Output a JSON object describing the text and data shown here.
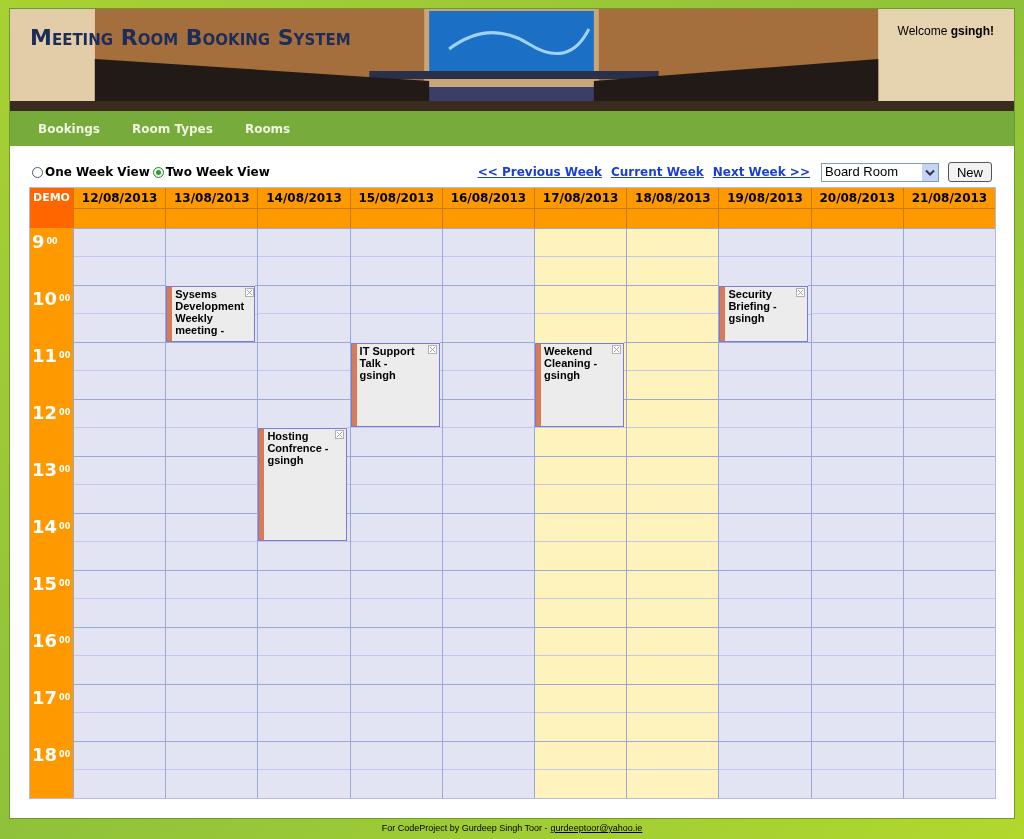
{
  "header": {
    "title": "Meeting Room Booking System",
    "welcome": "Welcome **gsingh!**"
  },
  "nav": [
    "Bookings",
    "Room Types",
    "Rooms"
  ],
  "views": [
    {
      "label": "One Week View",
      "selected": false
    },
    {
      "label": "Two Week View",
      "selected": true
    }
  ],
  "links": [
    "<< Previous Week",
    "Current Week",
    "Next Week >>"
  ],
  "room_select": {
    "value": "Board Room"
  },
  "new_button": "New",
  "calendar": {
    "corner": "DEMO",
    "hours": [
      {
        "hour": "9",
        "minutes": "00"
      },
      {
        "hour": "10",
        "minutes": "00"
      },
      {
        "hour": "11",
        "minutes": "00"
      },
      {
        "hour": "12",
        "minutes": "00"
      },
      {
        "hour": "13",
        "minutes": "00"
      },
      {
        "hour": "14",
        "minutes": "00"
      },
      {
        "hour": "15",
        "minutes": "00"
      },
      {
        "hour": "16",
        "minutes": "00"
      },
      {
        "hour": "17",
        "minutes": "00"
      },
      {
        "hour": "18",
        "minutes": "00"
      }
    ],
    "days": [
      {
        "date": "12/08/2013",
        "weekend": false,
        "slots": [
          {
            "kind": "free"
          },
          {
            "kind": "free"
          },
          {
            "kind": "free"
          },
          {
            "kind": "free"
          },
          {
            "kind": "free"
          },
          {
            "kind": "free"
          },
          {
            "kind": "free"
          },
          {
            "kind": "free"
          },
          {
            "kind": "free"
          },
          {
            "kind": "free"
          },
          {
            "kind": "free"
          },
          {
            "kind": "free"
          },
          {
            "kind": "free"
          },
          {
            "kind": "free"
          },
          {
            "kind": "free"
          },
          {
            "kind": "free"
          },
          {
            "kind": "free"
          },
          {
            "kind": "free"
          },
          {
            "kind": "free"
          },
          {
            "kind": "free"
          }
        ]
      },
      {
        "date": "13/08/2013",
        "weekend": false,
        "slots": [
          {
            "kind": "free"
          },
          {
            "kind": "free"
          },
          {
            "kind": "booking",
            "title": "Sysems Development Weekly meeting -"
          },
          {
            "kind": "booked"
          },
          {
            "kind": "free"
          },
          {
            "kind": "free"
          },
          {
            "kind": "free"
          },
          {
            "kind": "free"
          },
          {
            "kind": "free"
          },
          {
            "kind": "free"
          },
          {
            "kind": "free"
          },
          {
            "kind": "free"
          },
          {
            "kind": "free"
          },
          {
            "kind": "free"
          },
          {
            "kind": "free"
          },
          {
            "kind": "free"
          },
          {
            "kind": "free"
          },
          {
            "kind": "free"
          },
          {
            "kind": "free"
          },
          {
            "kind": "free"
          }
        ]
      },
      {
        "date": "14/08/2013",
        "weekend": false,
        "slots": [
          {
            "kind": "free"
          },
          {
            "kind": "free"
          },
          {
            "kind": "free"
          },
          {
            "kind": "free"
          },
          {
            "kind": "free"
          },
          {
            "kind": "free"
          },
          {
            "kind": "free"
          },
          {
            "kind": "booking",
            "title": "Hosting Confrence - gsingh"
          },
          {
            "kind": "booked"
          },
          {
            "kind": "booked"
          },
          {
            "kind": "booked"
          },
          {
            "kind": "free"
          },
          {
            "kind": "free"
          },
          {
            "kind": "free"
          },
          {
            "kind": "free"
          },
          {
            "kind": "free"
          },
          {
            "kind": "free"
          },
          {
            "kind": "free"
          },
          {
            "kind": "free"
          },
          {
            "kind": "free"
          }
        ]
      },
      {
        "date": "15/08/2013",
        "weekend": false,
        "slots": [
          {
            "kind": "free"
          },
          {
            "kind": "free"
          },
          {
            "kind": "free"
          },
          {
            "kind": "free"
          },
          {
            "kind": "booking",
            "title": "IT Support Talk - gsingh"
          },
          {
            "kind": "booked"
          },
          {
            "kind": "booked"
          },
          {
            "kind": "free"
          },
          {
            "kind": "free"
          },
          {
            "kind": "free"
          },
          {
            "kind": "free"
          },
          {
            "kind": "free"
          },
          {
            "kind": "free"
          },
          {
            "kind": "free"
          },
          {
            "kind": "free"
          },
          {
            "kind": "free"
          },
          {
            "kind": "free"
          },
          {
            "kind": "free"
          },
          {
            "kind": "free"
          },
          {
            "kind": "free"
          }
        ]
      },
      {
        "date": "16/08/2013",
        "weekend": false,
        "slots": [
          {
            "kind": "free"
          },
          {
            "kind": "free"
          },
          {
            "kind": "free"
          },
          {
            "kind": "free"
          },
          {
            "kind": "free"
          },
          {
            "kind": "free"
          },
          {
            "kind": "free"
          },
          {
            "kind": "free"
          },
          {
            "kind": "free"
          },
          {
            "kind": "free"
          },
          {
            "kind": "free"
          },
          {
            "kind": "free"
          },
          {
            "kind": "free"
          },
          {
            "kind": "free"
          },
          {
            "kind": "free"
          },
          {
            "kind": "free"
          },
          {
            "kind": "free"
          },
          {
            "kind": "free"
          },
          {
            "kind": "free"
          },
          {
            "kind": "free"
          }
        ]
      },
      {
        "date": "17/08/2013",
        "weekend": true,
        "slots": [
          {
            "kind": "free"
          },
          {
            "kind": "free"
          },
          {
            "kind": "free"
          },
          {
            "kind": "free"
          },
          {
            "kind": "booking",
            "title": "Weekend Cleaning - gsingh"
          },
          {
            "kind": "booked"
          },
          {
            "kind": "booked"
          },
          {
            "kind": "free"
          },
          {
            "kind": "free"
          },
          {
            "kind": "free"
          },
          {
            "kind": "free"
          },
          {
            "kind": "free"
          },
          {
            "kind": "free"
          },
          {
            "kind": "free"
          },
          {
            "kind": "free"
          },
          {
            "kind": "free"
          },
          {
            "kind": "free"
          },
          {
            "kind": "free"
          },
          {
            "kind": "free"
          },
          {
            "kind": "free"
          }
        ]
      },
      {
        "date": "18/08/2013",
        "weekend": true,
        "slots": [
          {
            "kind": "free"
          },
          {
            "kind": "free"
          },
          {
            "kind": "free"
          },
          {
            "kind": "free"
          },
          {
            "kind": "free"
          },
          {
            "kind": "free"
          },
          {
            "kind": "free"
          },
          {
            "kind": "free"
          },
          {
            "kind": "free"
          },
          {
            "kind": "free"
          },
          {
            "kind": "free"
          },
          {
            "kind": "free"
          },
          {
            "kind": "free"
          },
          {
            "kind": "free"
          },
          {
            "kind": "free"
          },
          {
            "kind": "free"
          },
          {
            "kind": "free"
          },
          {
            "kind": "free"
          },
          {
            "kind": "free"
          },
          {
            "kind": "free"
          }
        ]
      },
      {
        "date": "19/08/2013",
        "weekend": false,
        "slots": [
          {
            "kind": "free"
          },
          {
            "kind": "free"
          },
          {
            "kind": "booking",
            "title": "Security Briefing - gsingh"
          },
          {
            "kind": "booked"
          },
          {
            "kind": "free"
          },
          {
            "kind": "free"
          },
          {
            "kind": "free"
          },
          {
            "kind": "free"
          },
          {
            "kind": "free"
          },
          {
            "kind": "free"
          },
          {
            "kind": "free"
          },
          {
            "kind": "free"
          },
          {
            "kind": "free"
          },
          {
            "kind": "free"
          },
          {
            "kind": "free"
          },
          {
            "kind": "free"
          },
          {
            "kind": "free"
          },
          {
            "kind": "free"
          },
          {
            "kind": "free"
          },
          {
            "kind": "free"
          }
        ]
      },
      {
        "date": "20/08/2013",
        "weekend": false,
        "slots": [
          {
            "kind": "free"
          },
          {
            "kind": "free"
          },
          {
            "kind": "free"
          },
          {
            "kind": "free"
          },
          {
            "kind": "free"
          },
          {
            "kind": "free"
          },
          {
            "kind": "free"
          },
          {
            "kind": "free"
          },
          {
            "kind": "free"
          },
          {
            "kind": "free"
          },
          {
            "kind": "free"
          },
          {
            "kind": "free"
          },
          {
            "kind": "free"
          },
          {
            "kind": "free"
          },
          {
            "kind": "free"
          },
          {
            "kind": "free"
          },
          {
            "kind": "free"
          },
          {
            "kind": "free"
          },
          {
            "kind": "free"
          },
          {
            "kind": "free"
          }
        ]
      },
      {
        "date": "21/08/2013",
        "weekend": false,
        "slots": [
          {
            "kind": "free"
          },
          {
            "kind": "free"
          },
          {
            "kind": "free"
          },
          {
            "kind": "free"
          },
          {
            "kind": "free"
          },
          {
            "kind": "free"
          },
          {
            "kind": "free"
          },
          {
            "kind": "free"
          },
          {
            "kind": "free"
          },
          {
            "kind": "free"
          },
          {
            "kind": "free"
          },
          {
            "kind": "free"
          },
          {
            "kind": "free"
          },
          {
            "kind": "free"
          },
          {
            "kind": "free"
          },
          {
            "kind": "free"
          },
          {
            "kind": "free"
          },
          {
            "kind": "free"
          },
          {
            "kind": "free"
          },
          {
            "kind": "free"
          }
        ]
      }
    ]
  },
  "footer": {
    "text": "For CodeProject by Gurdeep Singh Toor -",
    "email": "gurdeeptoor@yahoo.ie"
  }
}
